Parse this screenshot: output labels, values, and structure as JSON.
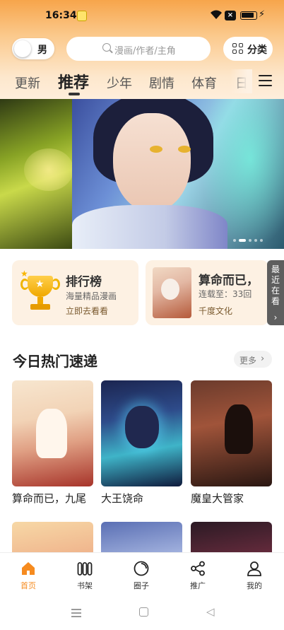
{
  "status": {
    "time": "16:34",
    "wifi_icon": "wifi-icon",
    "close_badge": "×",
    "battery_icon": "battery-icon",
    "charging": "charging-icon"
  },
  "header": {
    "gender_toggle": {
      "label": "男",
      "on": false
    },
    "search": {
      "placeholder": "漫画/作者/主角"
    },
    "category_button": {
      "label": "分类",
      "icon": "grid-icon"
    }
  },
  "tabs": [
    {
      "label": "更新",
      "active": false
    },
    {
      "label": "推荐",
      "active": true
    },
    {
      "label": "少年",
      "active": false
    },
    {
      "label": "剧情",
      "active": false
    },
    {
      "label": "体育",
      "active": false
    },
    {
      "label": "日",
      "active": false
    }
  ],
  "banner": {
    "slides": 5,
    "current": 1
  },
  "cards": {
    "ranking": {
      "title": "排行榜",
      "line1": "海量精品漫画",
      "line2": "立即去看看",
      "icon": "trophy-icon"
    },
    "recent": {
      "title": "算命而已，",
      "line1": "连载至：33回",
      "line2": "千度文化"
    },
    "recent_tab": {
      "chars": [
        "最",
        "近",
        "在",
        "看"
      ],
      "arrow": "›"
    }
  },
  "section": {
    "title": "今日热门速递",
    "more_label": "更多",
    "more_chevron": "›"
  },
  "comics": [
    {
      "title": "算命而已，九尾"
    },
    {
      "title": "大王饶命"
    },
    {
      "title": "魔皇大管家"
    }
  ],
  "tabbar": [
    {
      "label": "首页",
      "icon": "home-icon",
      "active": true
    },
    {
      "label": "书架",
      "icon": "bookshelf-icon",
      "active": false
    },
    {
      "label": "圈子",
      "icon": "circle-icon",
      "active": false
    },
    {
      "label": "推广",
      "icon": "share-icon",
      "active": false
    },
    {
      "label": "我的",
      "icon": "profile-icon",
      "active": false
    }
  ],
  "colors": {
    "accent": "#f68b1f",
    "card_bg": "#fdf1e3",
    "header_gradient_top": "#f7a54b"
  }
}
